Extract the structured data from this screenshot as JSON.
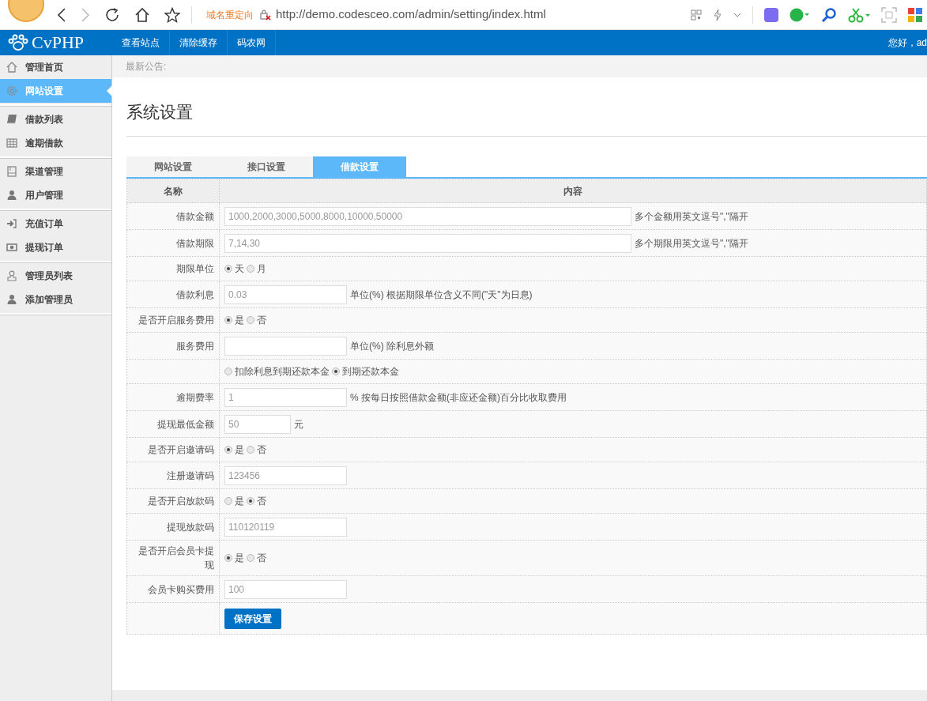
{
  "browser": {
    "redirect_label": "域名重定向",
    "url": "http://demo.codesceo.com/admin/setting/index.html"
  },
  "header": {
    "logo": "CvPHP",
    "nav": [
      "查看站点",
      "清除缓存",
      "码农网"
    ],
    "greeting": "您好，ad"
  },
  "sidebar": {
    "groups": [
      [
        {
          "label": "管理首页",
          "selected": false
        },
        {
          "label": "网站设置",
          "selected": true
        }
      ],
      [
        {
          "label": "借款列表",
          "selected": false
        },
        {
          "label": "逾期借款",
          "selected": false
        }
      ],
      [
        {
          "label": "渠道管理",
          "selected": false
        },
        {
          "label": "用户管理",
          "selected": false
        }
      ],
      [
        {
          "label": "充值订单",
          "selected": false
        },
        {
          "label": "提现订单",
          "selected": false
        }
      ],
      [
        {
          "label": "管理员列表",
          "selected": false
        },
        {
          "label": "添加管理员",
          "selected": false
        }
      ]
    ]
  },
  "notice": "最新公告:",
  "page_title": "系统设置",
  "tabs": [
    {
      "label": "网站设置",
      "selected": false
    },
    {
      "label": "接口设置",
      "selected": false
    },
    {
      "label": "借款设置",
      "selected": true
    }
  ],
  "table": {
    "columns": [
      "名称",
      "内容"
    ],
    "rows": [
      {
        "label": "借款金额",
        "kind": "wide_input",
        "value": "1000,2000,3000,5000,8000,10000,50000",
        "note": "多个金额用英文逗号\",\"隔开"
      },
      {
        "label": "借款期限",
        "kind": "wide_input",
        "value": "7,14,30",
        "note": "多个期限用英文逗号\",\"隔开"
      },
      {
        "label": "期限单位",
        "kind": "radio",
        "options": [
          {
            "label": "天",
            "selected": true
          },
          {
            "label": "月",
            "selected": false
          }
        ]
      },
      {
        "label": "借款利息",
        "kind": "input",
        "value": "0.03",
        "note": "单位(%) 根据期限单位含义不同(\"天\"为日息)"
      },
      {
        "label": "是否开启服务费用",
        "kind": "radio",
        "options": [
          {
            "label": "是",
            "selected": true
          },
          {
            "label": "否",
            "selected": false
          }
        ]
      },
      {
        "label": "服务费用",
        "kind": "input",
        "note": "单位(%) 除利息外额"
      },
      {
        "kind": "radio",
        "options": [
          {
            "label": "扣除利息到期还款本金",
            "selected": false
          },
          {
            "label": "到期还款本金",
            "selected": true
          }
        ]
      },
      {
        "label": "逾期费率",
        "kind": "input",
        "value": "1",
        "note": "% 按每日按照借款金额(非应还金额)百分比收取费用"
      },
      {
        "label": "提现最低金额",
        "kind": "short_input",
        "value": "50",
        "note": "元"
      },
      {
        "label": "是否开启邀请码",
        "kind": "radio",
        "options": [
          {
            "label": "是",
            "selected": true
          },
          {
            "label": "否",
            "selected": false
          }
        ]
      },
      {
        "label": "注册邀请码",
        "kind": "input",
        "value": "123456"
      },
      {
        "label": "是否开启放款码",
        "kind": "radio",
        "options": [
          {
            "label": "是",
            "selected": false
          },
          {
            "label": "否",
            "selected": true
          }
        ]
      },
      {
        "label": "提现放款码",
        "kind": "input",
        "value": "110120119"
      },
      {
        "label": "是否开启会员卡提现",
        "kind": "radio",
        "options": [
          {
            "label": "是",
            "selected": true
          },
          {
            "label": "否",
            "selected": false
          }
        ]
      },
      {
        "label": "会员卡购买费用",
        "kind": "input",
        "value": "100"
      }
    ]
  },
  "save_button": "保存设置"
}
